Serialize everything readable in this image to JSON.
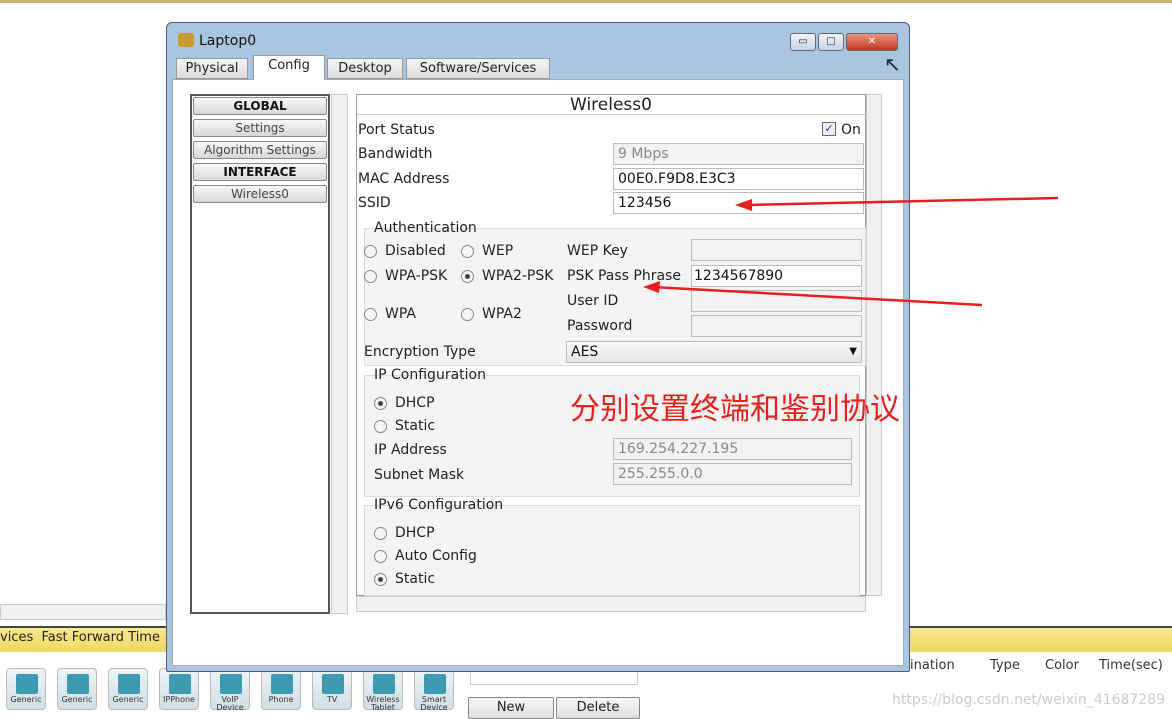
{
  "window": {
    "title": "Laptop0",
    "tabs": [
      "Physical",
      "Config",
      "Desktop",
      "Software/Services"
    ],
    "active_tab": "Config"
  },
  "sidebar": {
    "items": [
      {
        "label": "GLOBAL",
        "header": true
      },
      {
        "label": "Settings"
      },
      {
        "label": "Algorithm Settings"
      },
      {
        "label": "INTERFACE",
        "header": true
      },
      {
        "label": "Wireless0"
      }
    ]
  },
  "panel": {
    "title": "Wireless0",
    "port_status_label": "Port Status",
    "port_on_label": "On",
    "port_on": true,
    "bandwidth_label": "Bandwidth",
    "bandwidth": "9 Mbps",
    "mac_label": "MAC Address",
    "mac": "00E0.F9D8.E3C3",
    "ssid_label": "SSID",
    "ssid": "123456",
    "auth": {
      "title": "Authentication",
      "options": [
        "Disabled",
        "WEP",
        "WPA-PSK",
        "WPA2-PSK",
        "WPA",
        "WPA2"
      ],
      "selected": "WPA2-PSK",
      "wep_key_label": "WEP Key",
      "wep_key": "",
      "psk_label": "PSK Pass Phrase",
      "psk": "1234567890",
      "user_id_label": "User ID",
      "user_id": "",
      "password_label": "Password",
      "password": ""
    },
    "encryption_label": "Encryption Type",
    "encryption": "AES",
    "ip": {
      "title": "IP Configuration",
      "dhcp": "DHCP",
      "static": "Static",
      "selected": "DHCP",
      "ip_label": "IP Address",
      "ip": "169.254.227.195",
      "mask_label": "Subnet Mask",
      "mask": "255.255.0.0"
    },
    "ipv6": {
      "title": "IPv6 Configuration",
      "dhcp": "DHCP",
      "auto": "Auto Config",
      "static": "Static",
      "selected": "Static"
    }
  },
  "annotation": {
    "text": "分别设置终端和鉴别协议",
    "color": "#e8201c"
  },
  "background": {
    "realtime_text": "vices  Fast Forward Time",
    "devices": [
      "Generic",
      "Generic",
      "Generic",
      "IPPhone",
      "VoIP Device",
      "Phone",
      "TV",
      "Wireless Tablet",
      "Smart Device"
    ],
    "scenario_new": "New",
    "scenario_delete": "Delete",
    "table_headers": [
      "ination",
      "Type",
      "Color",
      "Time(sec)"
    ],
    "watermark": "https://blog.csdn.net/weixin_41687289"
  }
}
